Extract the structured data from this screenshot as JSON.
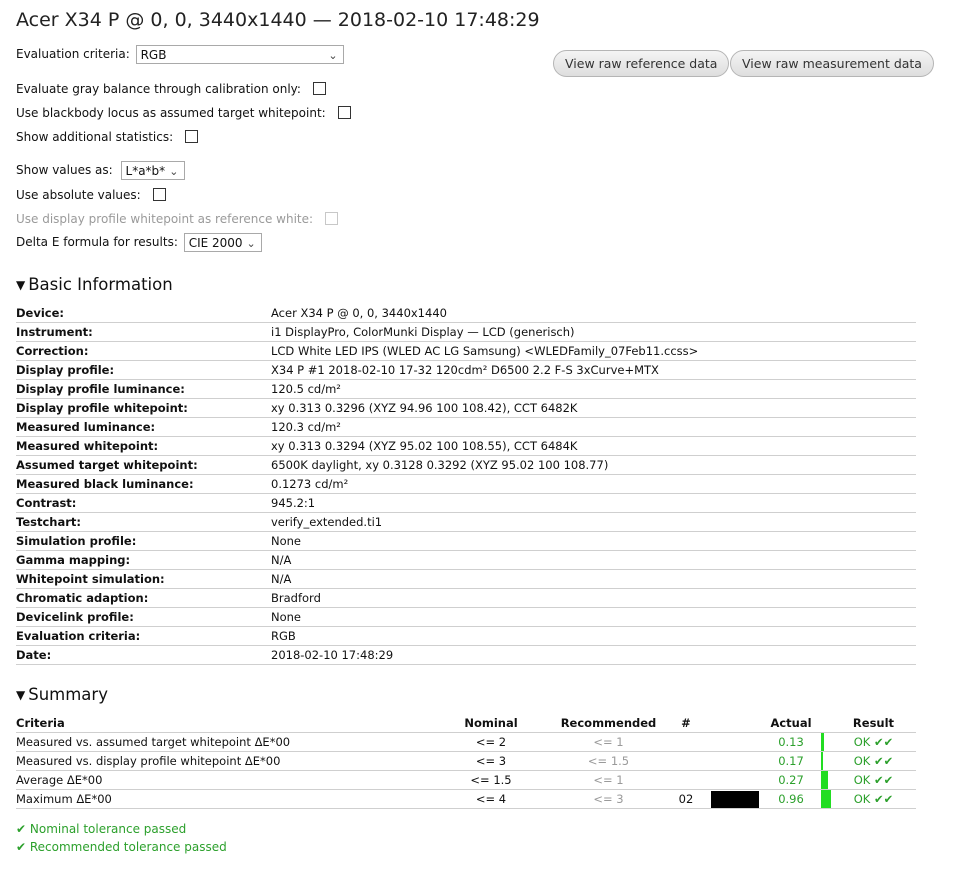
{
  "title": "Acer X34 P @ 0, 0, 3440x1440 — 2018-02-10 17:48:29",
  "options": {
    "evaluation_criteria_label": "Evaluation criteria:",
    "evaluation_criteria_value": "RGB",
    "gray_balance_label": "Evaluate gray balance through calibration only:",
    "blackbody_label": "Use blackbody locus as assumed target whitepoint:",
    "additional_stats_label": "Show additional statistics:",
    "show_values_label": "Show values as:",
    "show_values_value": "L*a*b*",
    "absolute_values_label": "Use absolute values:",
    "display_whitepoint_label": "Use display profile whitepoint as reference white:",
    "delta_e_label": "Delta E formula for results:",
    "delta_e_value": "CIE 2000"
  },
  "buttons": {
    "raw_reference": "View raw reference data",
    "raw_measurement": "View raw measurement data"
  },
  "basic_info": {
    "heading": "Basic Information",
    "rows": [
      {
        "key": "Device:",
        "value": "Acer X34 P @ 0, 0, 3440x1440"
      },
      {
        "key": "Instrument:",
        "value": "i1 DisplayPro, ColorMunki Display — LCD (generisch)"
      },
      {
        "key": "Correction:",
        "value": "LCD White LED IPS (WLED AC LG Samsung) <WLEDFamily_07Feb11.ccss>"
      },
      {
        "key": "Display profile:",
        "value": "X34 P #1 2018-02-10 17-32 120cdm² D6500 2.2 F-S 3xCurve+MTX"
      },
      {
        "key": "Display profile luminance:",
        "value": "120.5 cd/m²"
      },
      {
        "key": "Display profile whitepoint:",
        "value": "xy 0.313 0.3296 (XYZ 94.96 100 108.42), CCT 6482K"
      },
      {
        "key": "Measured luminance:",
        "value": "120.3 cd/m²"
      },
      {
        "key": "Measured whitepoint:",
        "value": "xy 0.313 0.3294 (XYZ 95.02 100 108.55), CCT 6484K"
      },
      {
        "key": "Assumed target whitepoint:",
        "value": "6500K daylight, xy 0.3128 0.3292 (XYZ 95.02 100 108.77)"
      },
      {
        "key": "Measured black luminance:",
        "value": "0.1273 cd/m²"
      },
      {
        "key": "Contrast:",
        "value": "945.2:1"
      },
      {
        "key": "Testchart:",
        "value": "verify_extended.ti1"
      },
      {
        "key": "Simulation profile:",
        "value": "None"
      },
      {
        "key": "Gamma mapping:",
        "value": "N/A"
      },
      {
        "key": "Whitepoint simulation:",
        "value": "N/A"
      },
      {
        "key": "Chromatic adaption:",
        "value": "Bradford"
      },
      {
        "key": "Devicelink profile:",
        "value": "None"
      },
      {
        "key": "Evaluation criteria:",
        "value": "RGB"
      },
      {
        "key": "Date:",
        "value": "2018-02-10 17:48:29"
      }
    ]
  },
  "summary": {
    "heading": "Summary",
    "headers": {
      "criteria": "Criteria",
      "nominal": "Nominal",
      "recommended": "Recommended",
      "num": "#",
      "actual": "Actual",
      "result": "Result"
    },
    "rows": [
      {
        "criteria": "Measured vs. assumed target whitepoint ΔE*00",
        "nominal": "<= 2",
        "recommended": "<= 1",
        "num": "",
        "actual": "0.13",
        "bar_fraction": 0.065,
        "result": "OK ✔✔"
      },
      {
        "criteria": "Measured vs. display profile whitepoint ΔE*00",
        "nominal": "<= 3",
        "recommended": "<= 1.5",
        "num": "",
        "actual": "0.17",
        "bar_fraction": 0.057,
        "result": "OK ✔✔"
      },
      {
        "criteria": "Average ΔE*00",
        "nominal": "<= 1.5",
        "recommended": "<= 1",
        "num": "",
        "actual": "0.27",
        "bar_fraction": 0.18,
        "result": "OK ✔✔"
      },
      {
        "criteria": "Maximum ΔE*00",
        "nominal": "<= 4",
        "recommended": "<= 3",
        "num": "02",
        "actual": "0.96",
        "bar_fraction": 0.24,
        "result": "OK ✔✔"
      }
    ],
    "nominal_passed": "✔ Nominal tolerance passed",
    "recommended_passed": "✔ Recommended tolerance passed"
  },
  "colors": {
    "pass_green": "#2ca02c",
    "bar_green": "#22dd22",
    "muted_gray": "#9a9a9a"
  }
}
